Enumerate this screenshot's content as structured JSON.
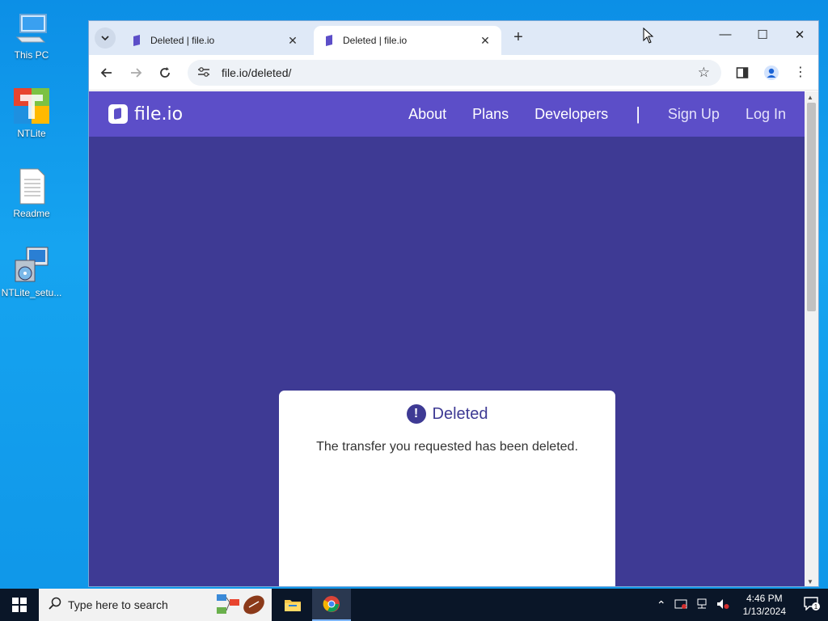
{
  "desktop": {
    "icons": [
      {
        "label": "This PC"
      },
      {
        "label": "NTLite"
      },
      {
        "label": "Readme"
      },
      {
        "label": "NTLite_setu..."
      }
    ]
  },
  "browser": {
    "tabs": [
      {
        "title": "Deleted | file.io"
      },
      {
        "title": "Deleted | file.io"
      }
    ],
    "address": "file.io/deleted/"
  },
  "site": {
    "logo_text": "file.io",
    "nav": {
      "about": "About",
      "plans": "Plans",
      "developers": "Developers",
      "separator": "|",
      "sign_up": "Sign Up",
      "log_in": "Log In"
    },
    "card": {
      "title": "Deleted",
      "message": "The transfer you requested has been deleted."
    }
  },
  "taskbar": {
    "search_placeholder": "Type here to search",
    "time": "4:46 PM",
    "date": "1/13/2024",
    "notification_count": "1"
  },
  "colors": {
    "page_bg": "#3e3a94",
    "header_bg": "#5c4ec8",
    "desktop_bg": "#0c8fe6"
  }
}
